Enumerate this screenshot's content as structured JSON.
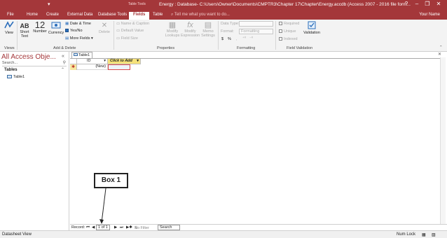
{
  "window": {
    "quick_access_glyph": "▾",
    "context_tab": "Table Tools",
    "document_title": "Energy : Database- C:\\Users\\Owner\\Documents\\CMPTR3\\Chapter 17\\Chapter\\Energy.accdb (Access 2007 - 2016 file form...",
    "help": "?",
    "minimize": "–",
    "restore": "❐",
    "close": "✕",
    "user": "Your Name"
  },
  "tabs": [
    {
      "label": "File"
    },
    {
      "label": "Home"
    },
    {
      "label": "Create"
    },
    {
      "label": "External Data"
    },
    {
      "label": "Database Tools"
    },
    {
      "label": "Fields"
    },
    {
      "label": "Table"
    }
  ],
  "tell_me": "Tell me what you want to do...",
  "ribbon": {
    "views": {
      "button": "View",
      "group": "Views"
    },
    "add_delete": {
      "short_text": "Short Text",
      "short_text_glyph": "AB",
      "number": "Number",
      "number_glyph": "12",
      "currency": "Currency",
      "date_time": "Date & Time",
      "yes_no": "Yes/No",
      "more_fields": "More Fields",
      "delete": "Delete",
      "group": "Add & Delete"
    },
    "properties": {
      "name_caption": "Name & Caption",
      "default_value": "Default Value",
      "field_size": "Field Size",
      "modify_lookups": "Modify Lookups",
      "modify_expression": "Modify Expression",
      "memo_settings": "Memo Settings",
      "expression_glyph": "fx",
      "group": "Properties"
    },
    "formatting": {
      "data_type_label": "Data Type:",
      "format_label": "Format:",
      "format_value": "Formatting",
      "dollar": "$",
      "percent": "%",
      "group": "Formatting"
    },
    "validation": {
      "required": "Required",
      "unique": "Unique",
      "indexed": "Indexed",
      "validation_button": "Validation",
      "group": "Field Validation"
    }
  },
  "nav_pane": {
    "title": "All Access Obje...",
    "collapse_glyph": "«",
    "search_placeholder": "Search...",
    "category": "Tables",
    "items": [
      {
        "label": "Table1"
      }
    ]
  },
  "document": {
    "tab_label": "Table1",
    "columns": [
      {
        "label": "ID"
      },
      {
        "label": "Click to Add"
      }
    ],
    "new_row_marker": "✱",
    "new_row_id": "(New)"
  },
  "record_nav": {
    "label": "Record:",
    "first": "⏮",
    "prev": "◀",
    "position": "1 of 1",
    "next": "▶",
    "last": "⏭",
    "new": "▶✱",
    "no_filter": "No Filter",
    "search": "Search"
  },
  "status_bar": {
    "view": "Datasheet View",
    "num_lock": "Num Lock"
  },
  "annotation": {
    "label": "Box 1"
  }
}
